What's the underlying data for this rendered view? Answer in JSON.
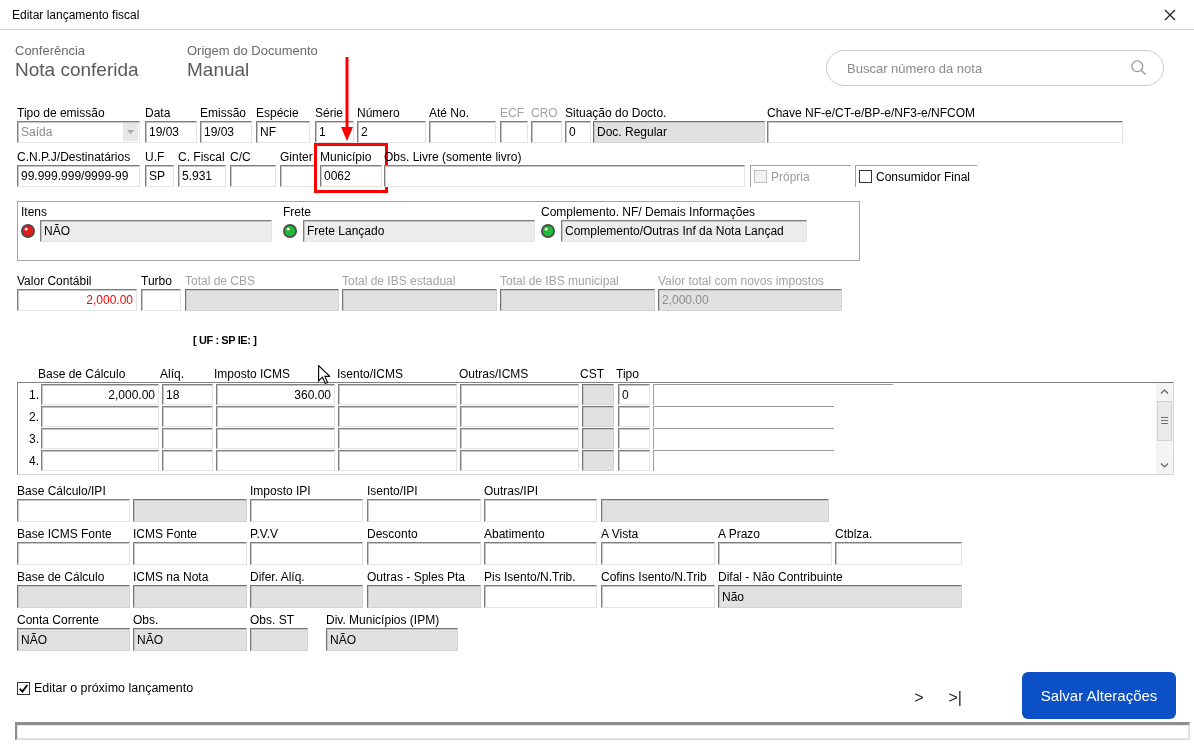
{
  "window": {
    "title": "Editar lançamento fiscal"
  },
  "summary": [
    {
      "label": "Conferência",
      "value": "Nota conferida"
    },
    {
      "label": "Origem do Documento",
      "value": "Manual"
    }
  ],
  "search": {
    "placeholder": "Buscar número da nota"
  },
  "document_row": [
    {
      "kind": "combo",
      "label": "Tipo de emissão",
      "value": "Saída",
      "readonly": false,
      "disabled": true
    },
    {
      "kind": "text",
      "label": "Data",
      "value": "19/03",
      "readonly": false,
      "disabled": false
    },
    {
      "kind": "text",
      "label": "Emissão",
      "value": "19/03",
      "readonly": false,
      "disabled": false
    },
    {
      "kind": "text",
      "label": "Espécie",
      "value": "NF",
      "readonly": false,
      "disabled": false
    },
    {
      "kind": "text",
      "label": "Série",
      "value": "1",
      "readonly": false,
      "disabled": false
    },
    {
      "kind": "text",
      "label": "Número",
      "value": "2",
      "readonly": false,
      "disabled": false
    },
    {
      "kind": "text",
      "label": "Até No.",
      "readonly": false,
      "disabled": false
    },
    {
      "kind": "text",
      "label": "ECF",
      "readonly": false,
      "disabled": true
    },
    {
      "kind": "text",
      "label": "CRO",
      "readonly": false,
      "disabled": true
    },
    {
      "kind": "text",
      "label": "Situação do Docto.",
      "value": "0",
      "readonly": false,
      "disabled": false
    },
    {
      "kind": "text",
      "value": "Doc. Regular",
      "readonly": true,
      "disabled": false
    },
    {
      "kind": "text",
      "label": "Chave NF-e/CT-e/BP-e/NF3-e/NFCOM",
      "readonly": false,
      "disabled": false
    }
  ],
  "party_row": [
    {
      "kind": "text",
      "label": "C.N.P.J/Destinatários",
      "value": "99.999.999/9999-99",
      "readonly": false,
      "disabled": false,
      "highlighted": false
    },
    {
      "kind": "text",
      "label": "U.F",
      "value": "SP",
      "readonly": false,
      "disabled": false,
      "highlighted": false
    },
    {
      "kind": "text",
      "label": "C. Fiscal",
      "value": "5.931",
      "readonly": false,
      "disabled": false,
      "highlighted": false
    },
    {
      "kind": "text",
      "label": "C/C",
      "readonly": false,
      "disabled": false,
      "highlighted": false
    },
    {
      "kind": "text",
      "label": "Ginter",
      "readonly": false,
      "disabled": false,
      "highlighted": false
    },
    {
      "kind": "text",
      "label": "Município",
      "value": "0062",
      "readonly": false,
      "disabled": false,
      "highlighted": true
    },
    {
      "kind": "text",
      "label": "Obs. Livre (somente livro)",
      "readonly": false,
      "disabled": false,
      "highlighted": false
    },
    {
      "kind": "checkbox",
      "label": "Própria",
      "checked": false,
      "disabled": true
    },
    {
      "kind": "checkbox",
      "label": "Consumidor Final",
      "checked": false,
      "disabled": false
    }
  ],
  "status_items": [
    {
      "label": "Itens",
      "value": "NÃO",
      "color": "#e01c1c",
      "readonly": true
    },
    {
      "label": "Frete",
      "value": "Frete Lançado",
      "color": "#22b83a",
      "readonly": true
    },
    {
      "label": "Complemento. NF/ Demais Informações",
      "value": "Complemento/Outras Inf da Nota Lançad",
      "color": "#22b83a",
      "readonly": true
    }
  ],
  "totals": [
    {
      "kind": "text",
      "label": "Valor Contábil",
      "value": "2,000.00",
      "color": "#ff0000",
      "readonly": false,
      "disabled": false
    },
    {
      "kind": "text",
      "label": "Turbo",
      "readonly": false,
      "disabled": false
    },
    {
      "kind": "text",
      "label": "Total de CBS",
      "readonly": true,
      "disabled": true
    },
    {
      "kind": "text",
      "label": "Total de IBS estadual",
      "readonly": true,
      "disabled": true
    },
    {
      "kind": "text",
      "label": "Total de IBS municipal",
      "readonly": true,
      "disabled": true
    },
    {
      "kind": "text",
      "label": "Valor total com novos impostos",
      "value": "2,000.00",
      "readonly": true,
      "disabled": true
    }
  ],
  "uf_info": "[ UF : SP IE: ]",
  "icms_table": {
    "columns": [
      {
        "label": "Base de Cálculo",
        "readonly": false
      },
      {
        "label": "Alíq.",
        "readonly": false
      },
      {
        "label": "Imposto ICMS",
        "readonly": false
      },
      {
        "label": "Isento/ICMS",
        "readonly": false
      },
      {
        "label": "Outras/ICMS",
        "readonly": false
      },
      {
        "label": "CST",
        "readonly": true
      },
      {
        "label": "Tipo",
        "readonly": false
      }
    ],
    "rows": [
      {
        "number": "1.",
        "cells": [
          {
            "value": "2,000.00"
          },
          {
            "value": "18"
          },
          {
            "value": "360.00"
          },
          {},
          {},
          {},
          {
            "value": "0"
          }
        ]
      },
      {
        "number": "2."
      },
      {
        "number": "3."
      },
      {
        "number": "4."
      }
    ]
  },
  "tax_rows": [
    {
      "fields": [
        {
          "kind": "text",
          "label": "Base Cálculo/IPI",
          "readonly": false,
          "disabled": false
        },
        {
          "kind": "text",
          "readonly": true
        },
        {
          "kind": "text",
          "label": "Imposto IPI",
          "readonly": false,
          "disabled": false
        },
        {
          "kind": "text",
          "label": "Isento/IPI",
          "readonly": false,
          "disabled": false
        },
        {
          "kind": "text",
          "label": "Outras/IPI",
          "readonly": false,
          "disabled": false
        },
        {
          "kind": "text",
          "readonly": true
        }
      ]
    },
    {
      "fields": [
        {
          "kind": "text",
          "label": "Base ICMS Fonte",
          "readonly": false,
          "disabled": false
        },
        {
          "kind": "text",
          "label": "ICMS Fonte",
          "readonly": false,
          "disabled": false
        },
        {
          "kind": "text",
          "label": "P.V.V",
          "readonly": false,
          "disabled": false
        },
        {
          "kind": "text",
          "label": "Desconto",
          "readonly": false,
          "disabled": false
        },
        {
          "kind": "text",
          "label": "Abatimento",
          "readonly": false,
          "disabled": false
        },
        {
          "kind": "text",
          "label": "A Vista",
          "readonly": false,
          "disabled": false
        },
        {
          "kind": "text",
          "label": "A Prazo",
          "readonly": false,
          "disabled": false
        },
        {
          "kind": "text",
          "label": "Ctblza.",
          "readonly": false,
          "disabled": false
        }
      ]
    },
    {
      "fields": [
        {
          "kind": "text",
          "label": "Base de Cálculo",
          "readonly": true,
          "disabled": false
        },
        {
          "kind": "text",
          "label": "ICMS na Nota",
          "readonly": true,
          "disabled": false
        },
        {
          "kind": "text",
          "label": "Difer. Alíq.",
          "readonly": true,
          "disabled": false
        },
        {
          "kind": "text",
          "label": "Outras - Sples Pta",
          "readonly": true,
          "disabled": false
        },
        {
          "kind": "text",
          "label": "Pis Isento/N.Trib.",
          "readonly": false,
          "disabled": false
        },
        {
          "kind": "text",
          "label": "Cofins Isento/N.Trib",
          "readonly": false,
          "disabled": false
        },
        {
          "kind": "text",
          "label": "Difal - Não Contribuinte",
          "value": "Não",
          "readonly": true,
          "disabled": false
        }
      ]
    },
    {
      "fields": [
        {
          "kind": "text",
          "label": "Conta Corrente",
          "value": "NÃO",
          "readonly": true,
          "disabled": false
        },
        {
          "kind": "text",
          "label": "Obs.",
          "value": "NÃO",
          "readonly": true,
          "disabled": false
        },
        {
          "kind": "text",
          "label": "Obs. ST",
          "readonly": true,
          "disabled": false
        },
        {
          "kind": "text",
          "label": "Div. Municípios (IPM)",
          "value": "NÃO",
          "readonly": true,
          "disabled": false
        }
      ]
    }
  ],
  "edit_next": {
    "label": "Editar o próximo lançamento",
    "checked": true
  },
  "navigation": [
    {
      "label": ">"
    },
    {
      "label": ">|"
    }
  ],
  "save_button": {
    "label": "Salvar Alterações"
  }
}
